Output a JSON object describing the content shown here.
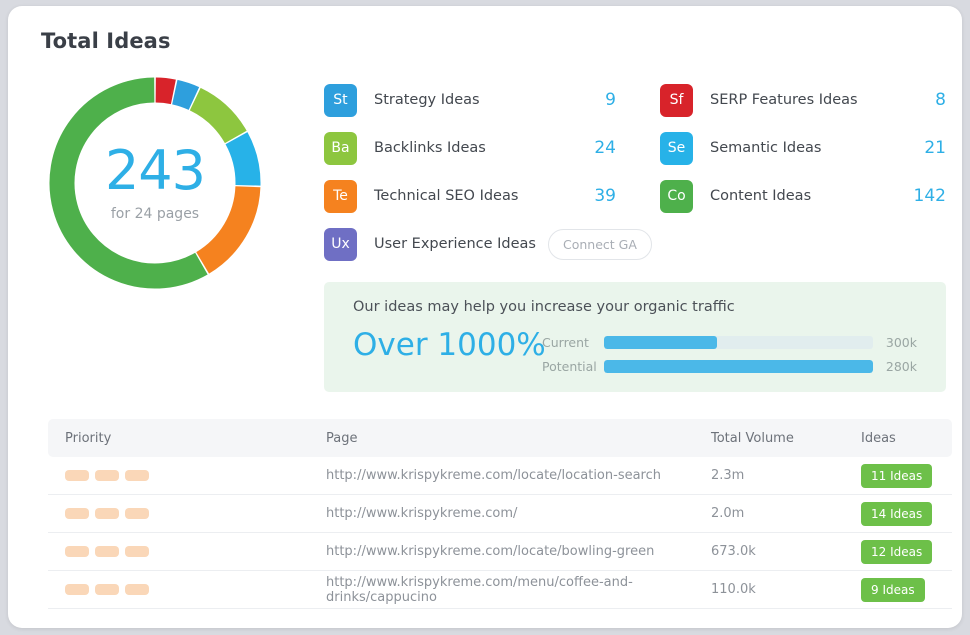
{
  "page_title": "Total Ideas",
  "donut": {
    "value": "243",
    "subtitle": "for 24 pages",
    "value_color": "#2eafe6"
  },
  "legend": {
    "left": [
      {
        "abbr": "St",
        "label": "Strategy Ideas",
        "count": "9",
        "color": "#2e9fdd",
        "has_button": false
      },
      {
        "abbr": "Ba",
        "label": "Backlinks Ideas",
        "count": "24",
        "color": "#8dc63f",
        "has_button": false
      },
      {
        "abbr": "Te",
        "label": "Technical SEO Ideas",
        "count": "39",
        "color": "#f5821f",
        "has_button": false
      },
      {
        "abbr": "Ux",
        "label": "User Experience Ideas",
        "count": "",
        "color": "#6f6fc4",
        "has_button": true,
        "button_label": "Connect GA"
      }
    ],
    "right": [
      {
        "abbr": "Sf",
        "label": "SERP Features Ideas",
        "count": "8",
        "color": "#d8232a",
        "has_button": false
      },
      {
        "abbr": "Se",
        "label": "Semantic Ideas",
        "count": "21",
        "color": "#27b2e8",
        "has_button": false
      },
      {
        "abbr": "Co",
        "label": "Content Ideas",
        "count": "142",
        "color": "#4eb04b",
        "has_button": false
      }
    ]
  },
  "traffic": {
    "heading": "Our ideas may help you increase your organic traffic",
    "highlight": "Over 1000%",
    "bars": [
      {
        "label": "Current",
        "value": "300k",
        "percent": 42
      },
      {
        "label": "Potential",
        "value": "280k",
        "percent": 100
      }
    ]
  },
  "table": {
    "columns": [
      "Priority",
      "Page",
      "Total Volume",
      "Ideas"
    ],
    "rows": [
      {
        "priority_blocks": 3,
        "page": "http://www.krispykreme.com/locate/location-search",
        "volume": "2.3m",
        "ideas": "11 Ideas"
      },
      {
        "priority_blocks": 3,
        "page": "http://www.krispykreme.com/",
        "volume": "2.0m",
        "ideas": "14 Ideas"
      },
      {
        "priority_blocks": 3,
        "page": "http://www.krispykreme.com/locate/bowling-green",
        "volume": "673.0k",
        "ideas": "12 Ideas"
      },
      {
        "priority_blocks": 3,
        "page": "http://www.krispykreme.com/menu/coffee-and-drinks/cappucino",
        "volume": "110.0k",
        "ideas": "9 Ideas"
      }
    ]
  },
  "chart_data": {
    "type": "pie",
    "title": "Total Ideas",
    "total": 243,
    "categories": [
      "SERP Features Ideas",
      "Strategy Ideas",
      "Backlinks Ideas",
      "Semantic Ideas",
      "Technical SEO Ideas",
      "Content Ideas"
    ],
    "values": [
      8,
      9,
      24,
      21,
      39,
      142
    ],
    "colors": [
      "#d8232a",
      "#2e9fdd",
      "#8dc63f",
      "#27b2e8",
      "#f5821f",
      "#4eb04b"
    ],
    "legend_position": "right",
    "donut": true,
    "start_angle": -90,
    "center_label": "243",
    "center_sublabel": "for 24 pages"
  }
}
